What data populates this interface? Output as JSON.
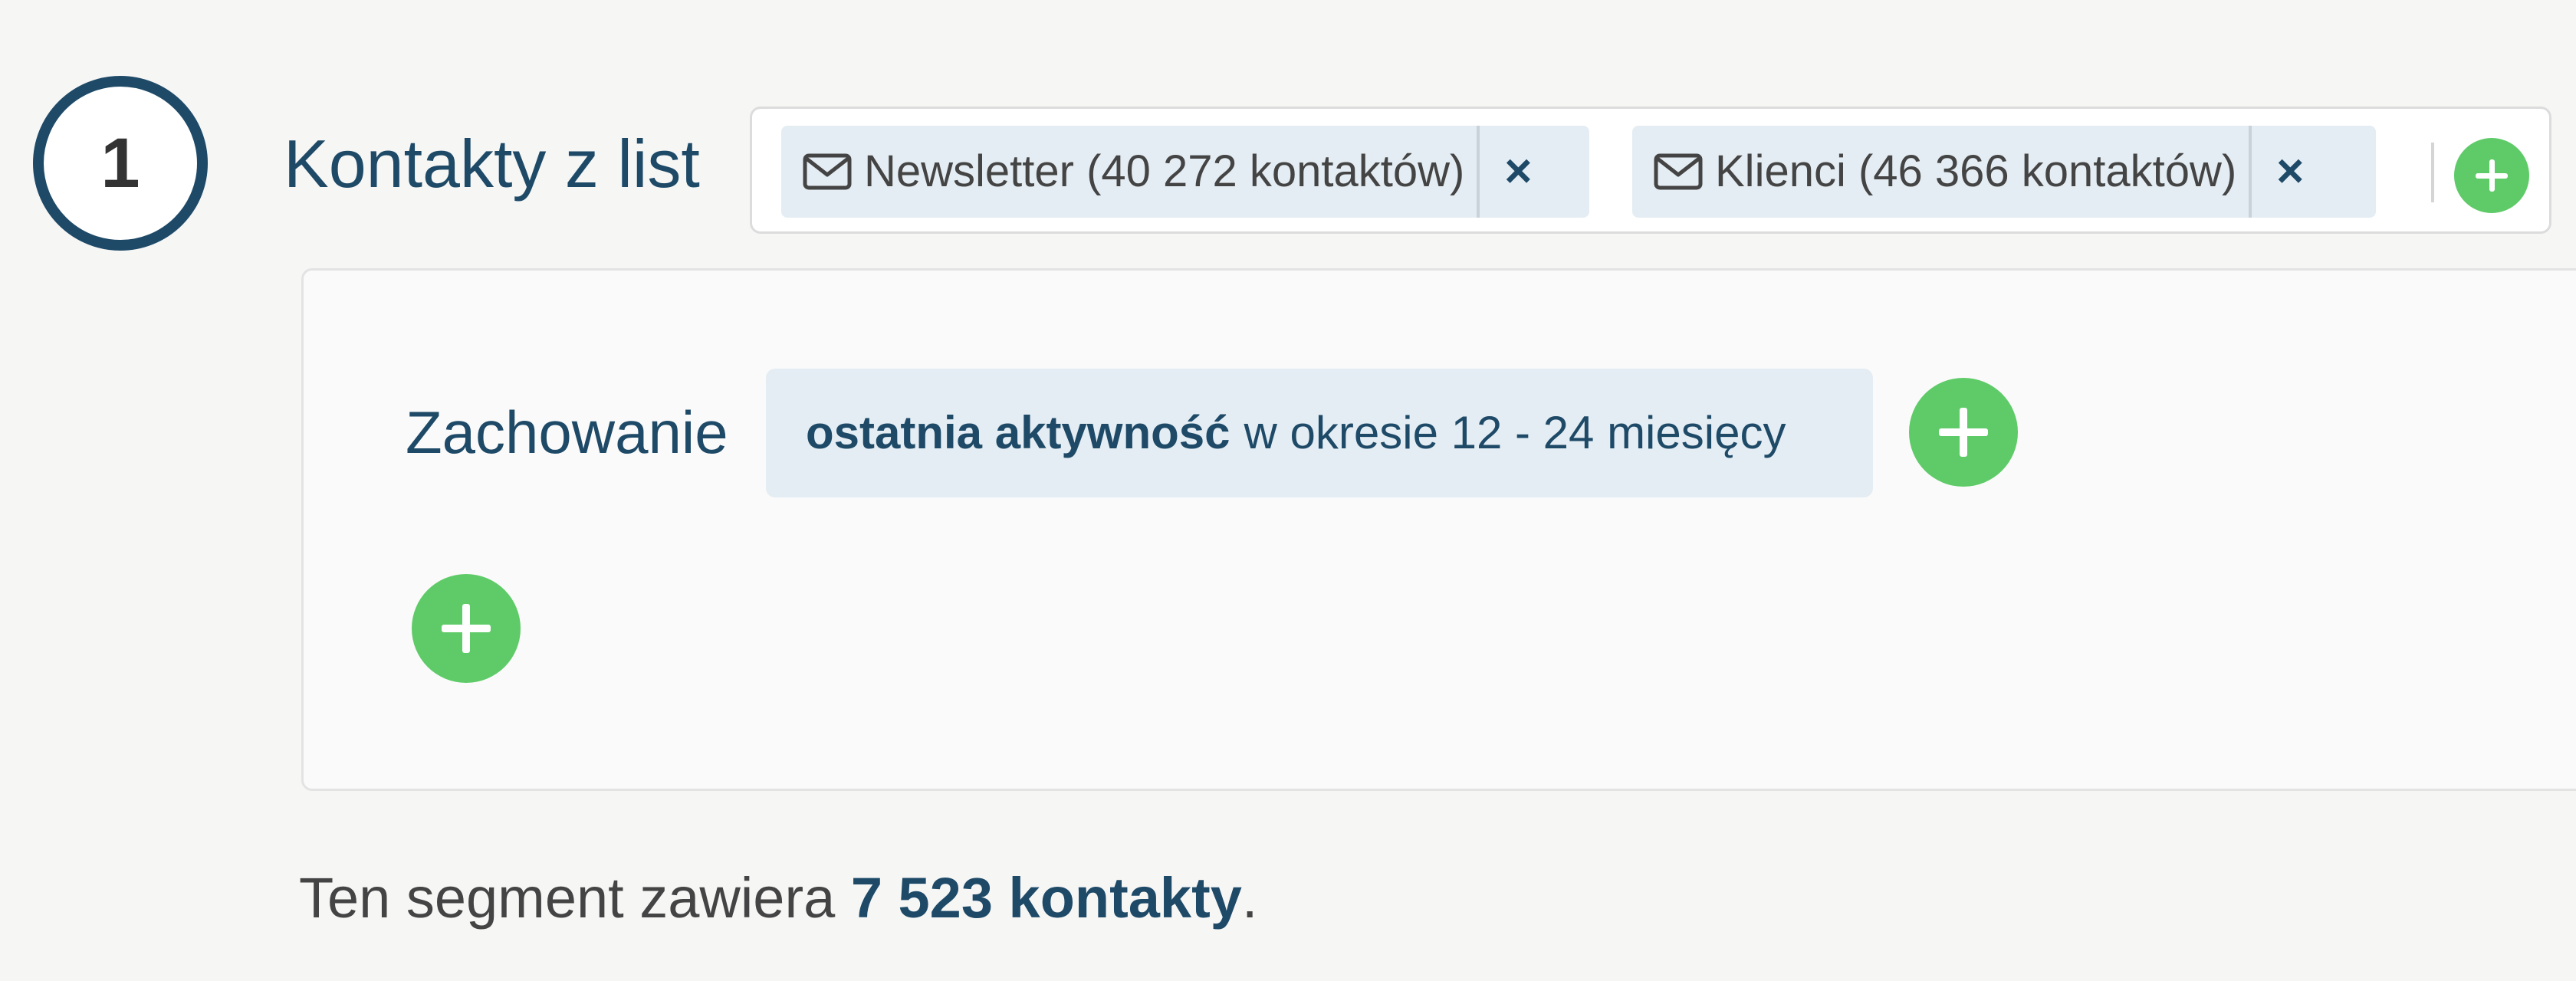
{
  "step": {
    "number": "1",
    "title": "Kontakty z list"
  },
  "lists": {
    "tags": [
      {
        "label": "Newsletter (40 272 kontaktów)",
        "remove": "×",
        "icon": "envelope-icon"
      },
      {
        "label": "Klienci (46 366 kontaktów)",
        "remove": "×",
        "icon": "envelope-icon"
      }
    ],
    "add_icon": "plus-icon"
  },
  "conditions": {
    "label": "Zachowanie",
    "tag_strong": "ostatnia aktywność",
    "tag_rest": "w okresie 12 - 24 miesięcy",
    "add_condition_icon": "plus-icon",
    "add_group_icon": "plus-icon"
  },
  "summary": {
    "prefix": "Ten segment zawiera ",
    "count": "7 523 kontakty",
    "suffix": "."
  },
  "colors": {
    "brand": "#1e4a68",
    "tag_background": "#e4edf3",
    "add_button": "#5ecb68",
    "body_text": "#444444"
  }
}
